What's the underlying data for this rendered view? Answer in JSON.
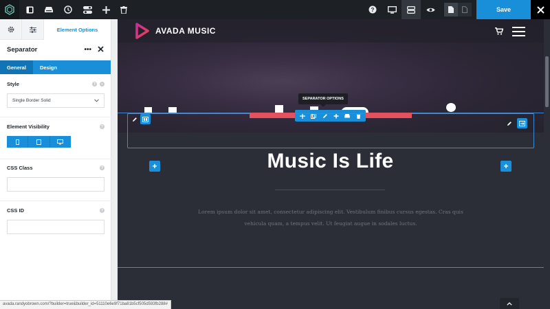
{
  "toolbar": {
    "icons": [
      "avada-logo-icon",
      "sidebar-toggle-icon",
      "library-icon",
      "history-icon",
      "toggle-icon",
      "add-icon",
      "trash-icon",
      "help-icon",
      "desktop-icon",
      "layout-icon",
      "preview-icon",
      "page-icon",
      "page-outline-icon",
      "close-icon"
    ],
    "save_label": "Save"
  },
  "sidebar": {
    "tabs": [
      "Element Options"
    ],
    "element_title": "Separator",
    "sub_tabs": [
      "General",
      "Design"
    ],
    "style": {
      "label": "Style",
      "value": "Single Border Solid"
    },
    "visibility": {
      "label": "Element Visibility",
      "devices": [
        "mobile",
        "tablet",
        "desktop"
      ]
    },
    "css_class": {
      "label": "CSS Class",
      "value": ""
    },
    "css_id": {
      "label": "CSS ID",
      "value": ""
    }
  },
  "site": {
    "brand": "AVADA MUSIC",
    "headline": "Music Is Life",
    "lorem": "Lorem ipsum dolor sit amet, consectetur adipiscing elit. Vestibulum finibus cursus egestas. Cras quis vehicula quam, a tempus velit. Ut feugiat augue in sodales luctus."
  },
  "builder": {
    "tooltip": "SEPARATOR OPTIONS",
    "separator_color": "#e3525e",
    "accent": "#198fd9"
  },
  "status_url": "avada.randyobrown.com/?builder=true&builder_id=51110e6e9f71ba81b5cf505d593fb288#"
}
